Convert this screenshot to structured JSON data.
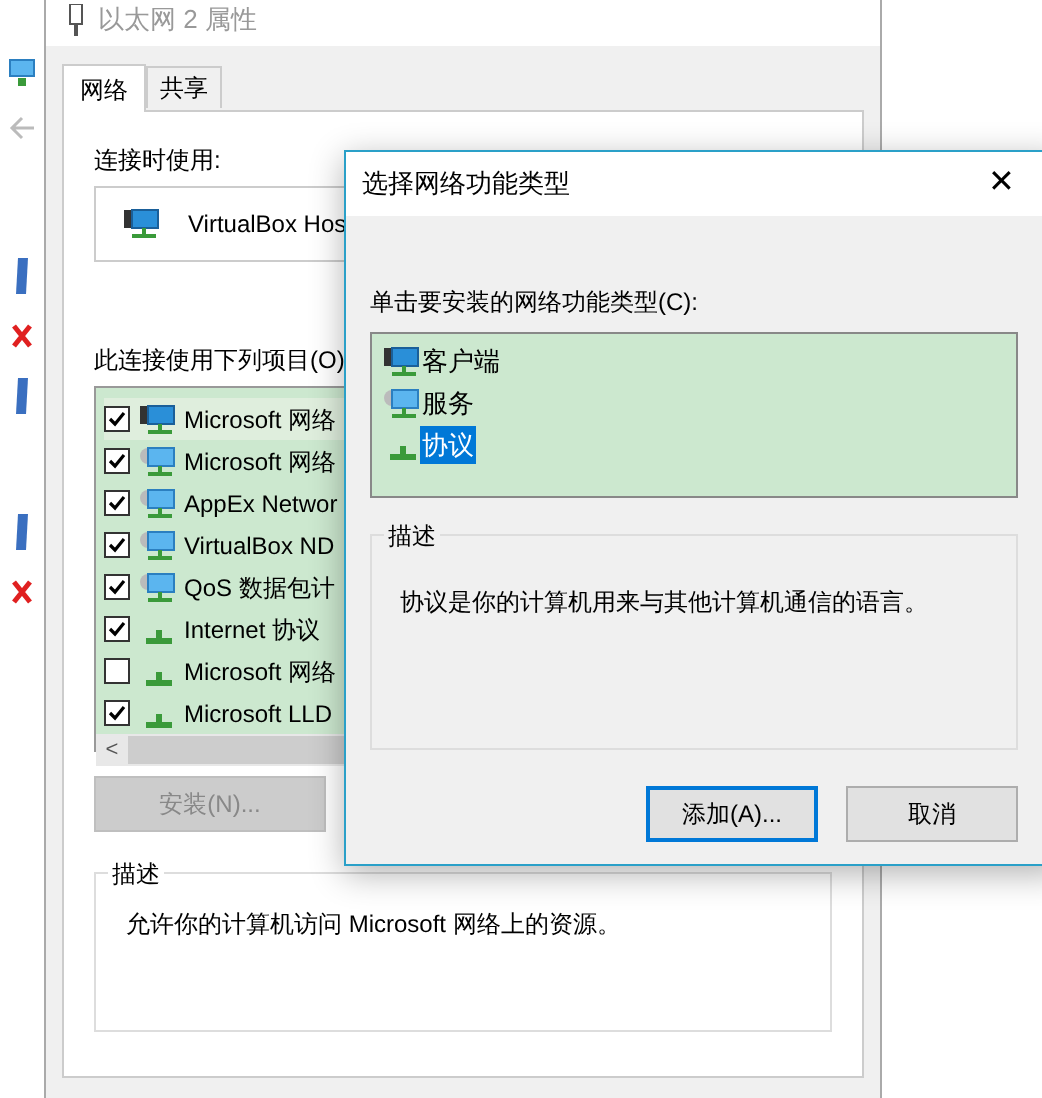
{
  "main_dialog": {
    "title": "以太网 2 属性",
    "tabs": [
      {
        "label": "网络",
        "selected": true
      },
      {
        "label": "共享",
        "selected": false
      }
    ],
    "connect_using_label": "连接时使用:",
    "adapter": "VirtualBox Hos",
    "items_label": "此连接使用下列项目(O)",
    "items": [
      {
        "label": "Microsoft 网络",
        "checked": true,
        "kind": "client",
        "selected": true
      },
      {
        "label": "Microsoft 网络",
        "checked": true,
        "kind": "service",
        "selected": false
      },
      {
        "label": "AppEx Networ",
        "checked": true,
        "kind": "service",
        "selected": false
      },
      {
        "label": "VirtualBox ND",
        "checked": true,
        "kind": "service",
        "selected": false
      },
      {
        "label": "QoS 数据包计",
        "checked": true,
        "kind": "service",
        "selected": false
      },
      {
        "label": "Internet 协议",
        "checked": true,
        "kind": "protocol",
        "selected": false
      },
      {
        "label": "Microsoft 网络",
        "checked": false,
        "kind": "protocol",
        "selected": false
      },
      {
        "label": "Microsoft LLD",
        "checked": true,
        "kind": "protocol",
        "selected": false
      }
    ],
    "scroll_left": "<",
    "install_button": {
      "label": "安装(N)...",
      "disabled": true
    },
    "description_title": "描述",
    "description": "允许你的计算机访问 Microsoft 网络上的资源。"
  },
  "type_dialog": {
    "title": "选择网络功能类型",
    "close": "✕",
    "prompt": "单击要安装的网络功能类型(C):",
    "types": [
      {
        "label": "客户端",
        "kind": "client",
        "selected": false
      },
      {
        "label": "服务",
        "kind": "service",
        "selected": false
      },
      {
        "label": "协议",
        "kind": "protocol",
        "selected": true
      }
    ],
    "description_title": "描述",
    "description": "协议是你的计算机用来与其他计算机通信的语言。",
    "buttons": [
      {
        "label": "添加(A)...",
        "focused": true
      },
      {
        "label": "取消",
        "focused": false
      }
    ]
  }
}
